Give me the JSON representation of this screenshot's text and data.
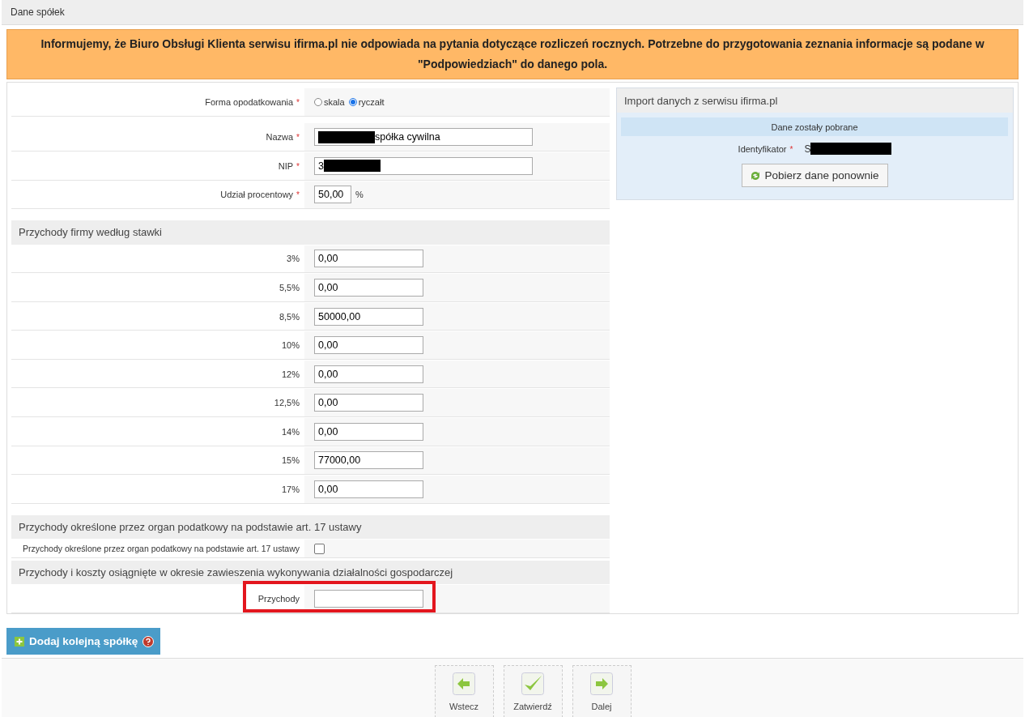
{
  "header": {
    "title": "Dane spółek"
  },
  "notice": "Informujemy, że Biuro Obsługi Klienta serwisu ifirma.pl nie odpowiada na pytania dotyczące rozliczeń rocznych. Potrzebne do przygotowania zeznania informacje są podane w \"Podpowiedziach\" do danego pola.",
  "tax_form": {
    "label": "Forma opodatkowania",
    "required_mark": "*",
    "options": [
      {
        "label": "skala",
        "selected": false
      },
      {
        "label": "ryczałt",
        "selected": true
      }
    ]
  },
  "fields": [
    {
      "label": "Nazwa",
      "required_mark": "*",
      "value": "spółka cywilna",
      "kind": "masked_start"
    },
    {
      "label": "NIP",
      "required_mark": "*",
      "value": "3",
      "kind": "masked_end"
    },
    {
      "label": "Udział procentowy",
      "required_mark": "*",
      "value": "50,00",
      "unit": "%",
      "kind": "percent"
    }
  ],
  "rates": {
    "title": "Przychody firmy według stawki",
    "rows": [
      {
        "label": "3%",
        "value": "0,00"
      },
      {
        "label": "5,5%",
        "value": "0,00"
      },
      {
        "label": "8,5%",
        "value": "50000,00"
      },
      {
        "label": "10%",
        "value": "0,00"
      },
      {
        "label": "12%",
        "value": "0,00"
      },
      {
        "label": "12,5%",
        "value": "0,00"
      },
      {
        "label": "14%",
        "value": "0,00"
      },
      {
        "label": "15%",
        "value": "77000,00"
      },
      {
        "label": "17%",
        "value": "0,00"
      }
    ]
  },
  "art17": {
    "title": "Przychody określone przez organ podatkowy na podstawie art. 17 ustawy",
    "label": "Przychody określone przez organ podatkowy na podstawie art. 17 ustawy",
    "checked": false
  },
  "suspension": {
    "title": "Przychody i koszty osiągnięte w okresie zawieszenia wykonywania działalności gospodarczej",
    "label": "Przychody",
    "highlighted": true
  },
  "import_panel": {
    "title": "Import danych z serwisu ifirma.pl",
    "status": "Dane zostały pobrane",
    "id_label": "Identyfikator",
    "required_mark": "*",
    "id_value": "S",
    "button": "Pobierz dane ponownie"
  },
  "add_button": {
    "label": "Dodaj kolejną spółkę"
  },
  "nav": [
    {
      "label": "Wstecz",
      "kind": "back"
    },
    {
      "label": "Zatwierdź",
      "kind": "confirm"
    },
    {
      "label": "Dalej",
      "kind": "next"
    }
  ]
}
